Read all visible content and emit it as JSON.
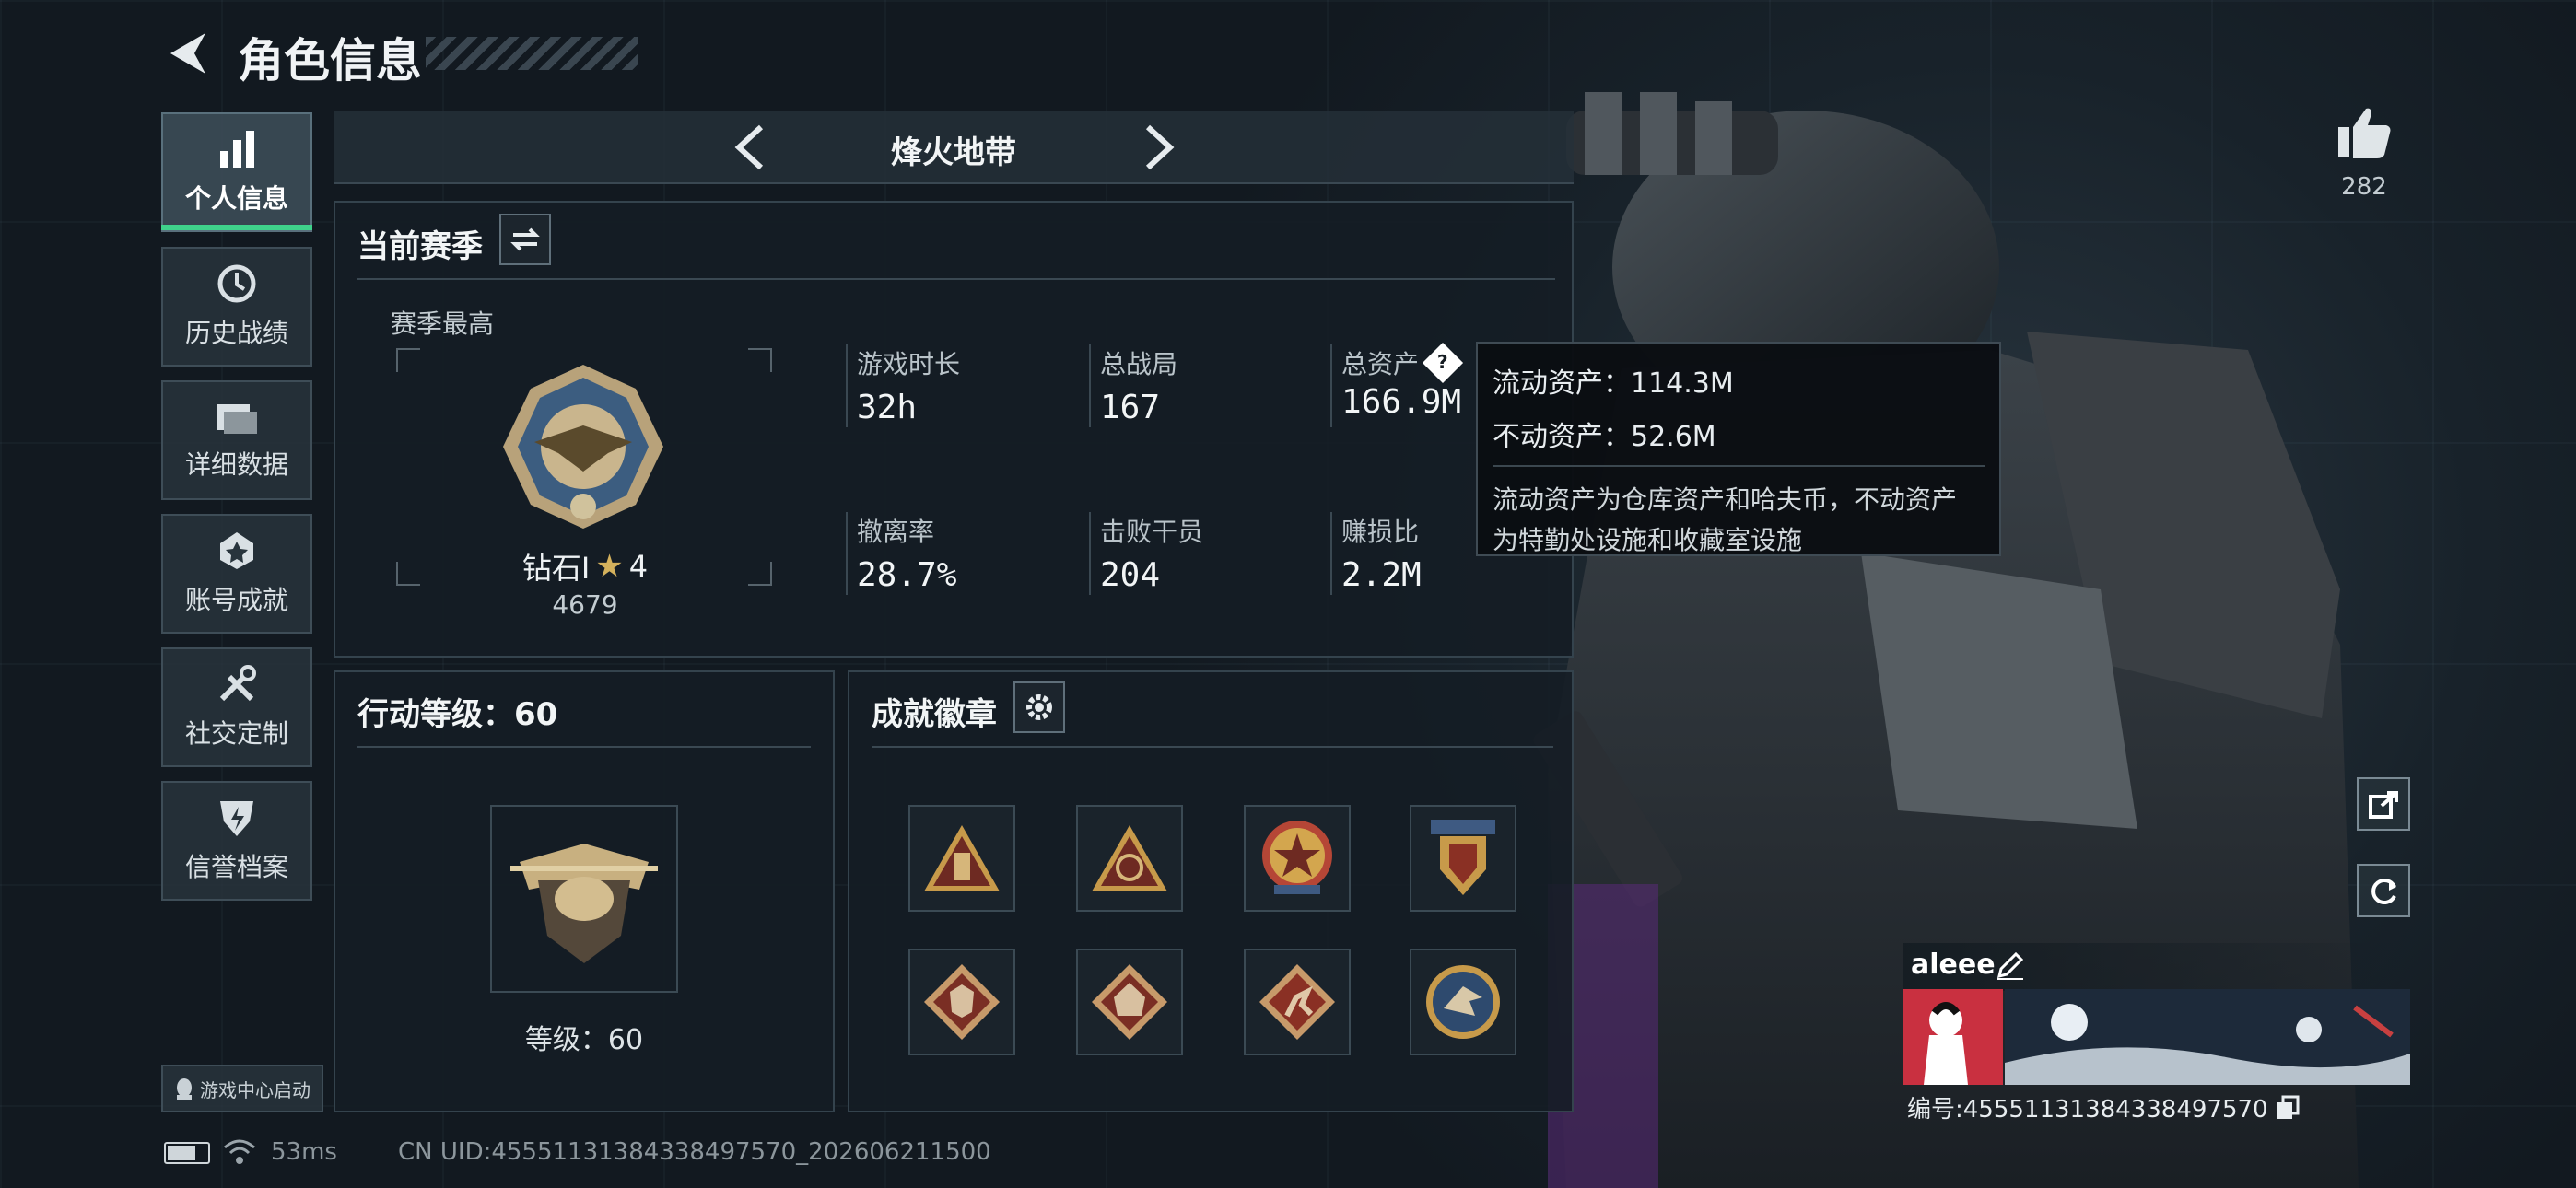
{
  "header": {
    "title": "角色信息"
  },
  "sidebar": {
    "items": [
      {
        "label": "个人信息",
        "icon": "bar-chart-icon"
      },
      {
        "label": "历史战绩",
        "icon": "history-icon"
      },
      {
        "label": "详细数据",
        "icon": "folder-icon"
      },
      {
        "label": "账号成就",
        "icon": "achievement-icon"
      },
      {
        "label": "社交定制",
        "icon": "tools-icon"
      },
      {
        "label": "信誉档案",
        "icon": "shield-icon"
      }
    ],
    "game_center": "游戏中心启动"
  },
  "mode_switch": {
    "label": "烽火地带"
  },
  "season": {
    "title": "当前赛季",
    "best_label": "赛季最高",
    "rank_name": "钻石Ⅰ",
    "rank_stars": "4",
    "rank_score": "4679",
    "stats": [
      {
        "label": "游戏时长",
        "value": "32h"
      },
      {
        "label": "总战局",
        "value": "167"
      },
      {
        "label": "总资产",
        "value": "166.9M"
      },
      {
        "label": "撤离率",
        "value": "28.7%"
      },
      {
        "label": "击败干员",
        "value": "204"
      },
      {
        "label": "赚损比",
        "value": "2.2M"
      }
    ]
  },
  "tooltip": {
    "liquid": "流动资产：114.3M",
    "fixed": "不动资产：52.6M",
    "note_line1": "流动资产为仓库资产和哈夫币，不动资产",
    "note_line2": "为特勤处设施和收藏室设施"
  },
  "level": {
    "title": "行动等级：60",
    "label": "等级：60"
  },
  "badges": {
    "title": "成就徽章",
    "items": [
      "ammo-badge-icon",
      "radar-badge-icon",
      "star-badge-icon",
      "wing-badge-icon",
      "wolf-badge-icon",
      "dragon-badge-icon",
      "runner-badge-icon",
      "eagle-badge-icon"
    ]
  },
  "profile": {
    "likes": "282",
    "name": "aleee",
    "id_text": "编号:4555113138433849757​0"
  },
  "statusbar": {
    "ping": "53ms",
    "uid": "CN UID:45551131384338497570_202606211500"
  },
  "colors": {
    "accent": "#3fd28b",
    "panel": "#141d24",
    "gold": "#c9a45a"
  }
}
